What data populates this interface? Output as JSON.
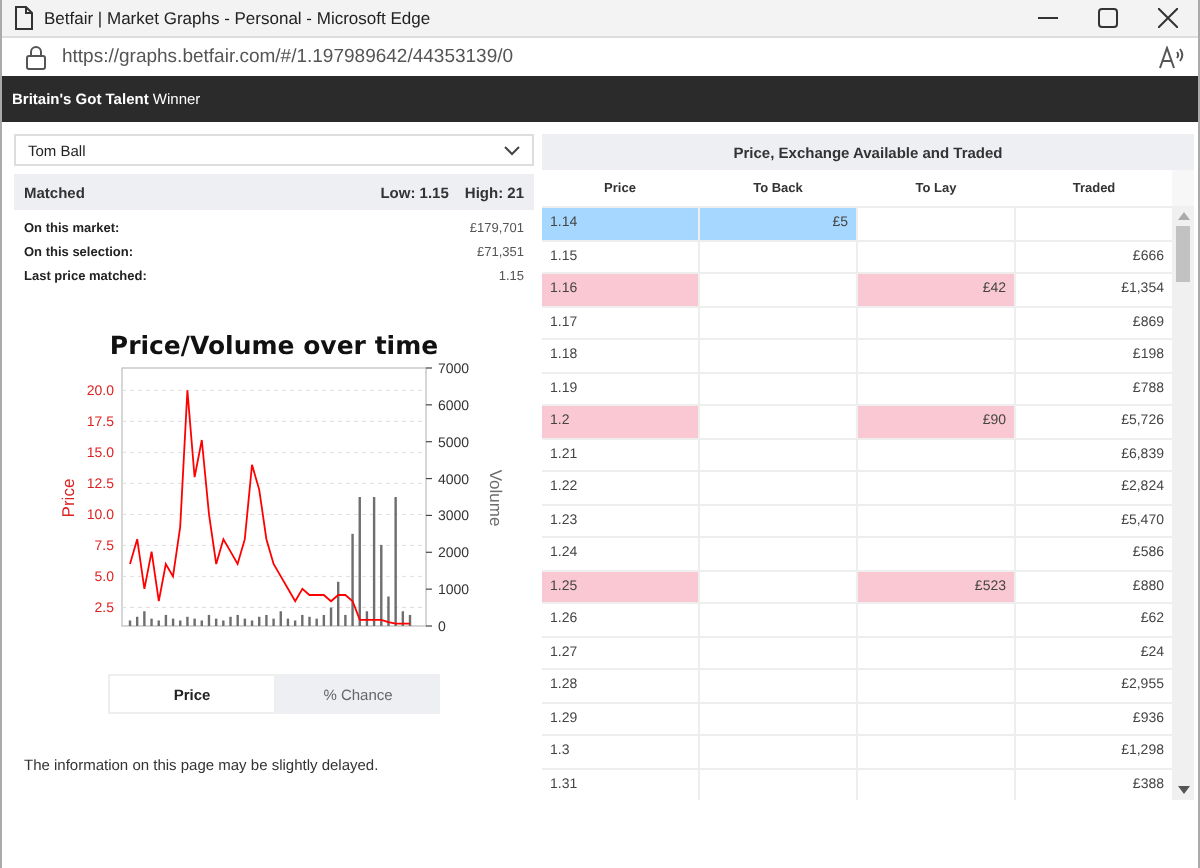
{
  "window": {
    "title": "Betfair | Market Graphs - Personal - Microsoft Edge"
  },
  "address_bar": {
    "url": "https://graphs.betfair.com/#/1.197989642/44353139/0"
  },
  "header": {
    "title": "**Britain's Got Talent** Winner"
  },
  "selection": {
    "value": "Tom Ball"
  },
  "matched": {
    "label": "Matched",
    "low": "Low: 1.15",
    "high": "High: 21"
  },
  "stats": [
    {
      "label": "On this market:",
      "value": "£179,701"
    },
    {
      "label": "On this selection:",
      "value": "£71,351"
    },
    {
      "label": "Last price matched:",
      "value": "1.15"
    }
  ],
  "chart_data": {
    "type": "line",
    "title": "Price/Volume over time",
    "grid": true,
    "ylim": [
      1,
      21.8
    ],
    "y2lim": [
      0,
      7000
    ],
    "yticks": [
      {
        "value": 20,
        "label": "20.0"
      },
      {
        "value": 17.5,
        "label": "17.5"
      },
      {
        "value": 15,
        "label": "15.0"
      },
      {
        "value": 12.5,
        "label": "12.5"
      },
      {
        "value": 10,
        "label": "10.0"
      },
      {
        "value": 7.5,
        "label": "7.5"
      },
      {
        "value": 5,
        "label": "5.0"
      },
      {
        "value": 2.5,
        "label": "2.5"
      }
    ],
    "y2ticks": [
      7000,
      6000,
      5000,
      4000,
      3000,
      2000,
      1000,
      0
    ],
    "series": [
      {
        "name": "Price",
        "color": "#ff0000",
        "values": [
          6,
          8,
          4,
          7,
          3,
          6,
          5,
          9,
          20,
          13,
          16,
          10,
          6,
          8,
          7,
          6,
          8,
          14,
          12,
          8,
          6,
          5,
          4,
          3,
          4,
          3.5,
          3.5,
          3.5,
          3,
          3.5,
          3.5,
          3,
          1.5,
          1.5,
          1.5,
          1.5,
          1.3,
          1.2,
          1.2,
          1.2
        ]
      },
      {
        "name": "Volume",
        "color": "#6e6e6e",
        "type": "bar",
        "axis": "y2",
        "values": [
          150,
          250,
          400,
          200,
          150,
          300,
          200,
          150,
          250,
          200,
          150,
          300,
          200,
          150,
          250,
          300,
          200,
          150,
          250,
          300,
          200,
          400,
          200,
          150,
          300,
          250,
          200,
          300,
          500,
          1200,
          300,
          2500,
          3500,
          400,
          3500,
          2200,
          800,
          3500,
          400,
          300
        ]
      }
    ]
  },
  "toggle": [
    {
      "label": "Price",
      "selected": true
    },
    {
      "label": "% Chance",
      "selected": false
    }
  ],
  "note": "The information on this page may be slightly delayed.",
  "table": {
    "title": "Price, Exchange Available and Traded",
    "columns": [
      "Price",
      "To Back",
      "To Lay",
      "Traded"
    ],
    "rows": [
      {
        "kind": "back",
        "price": "1.14",
        "back": "£5",
        "lay": "",
        "traded": ""
      },
      {
        "kind": "plain",
        "price": "1.15",
        "back": "",
        "lay": "",
        "traded": "£666"
      },
      {
        "kind": "lay",
        "price": "1.16",
        "back": "",
        "lay": "£42",
        "traded": "£1,354"
      },
      {
        "kind": "plain",
        "price": "1.17",
        "back": "",
        "lay": "",
        "traded": "£869"
      },
      {
        "kind": "plain",
        "price": "1.18",
        "back": "",
        "lay": "",
        "traded": "£198"
      },
      {
        "kind": "plain",
        "price": "1.19",
        "back": "",
        "lay": "",
        "traded": "£788"
      },
      {
        "kind": "lay",
        "price": "1.2",
        "back": "",
        "lay": "£90",
        "traded": "£5,726"
      },
      {
        "kind": "plain",
        "price": "1.21",
        "back": "",
        "lay": "",
        "traded": "£6,839"
      },
      {
        "kind": "plain",
        "price": "1.22",
        "back": "",
        "lay": "",
        "traded": "£2,824"
      },
      {
        "kind": "plain",
        "price": "1.23",
        "back": "",
        "lay": "",
        "traded": "£5,470"
      },
      {
        "kind": "plain",
        "price": "1.24",
        "back": "",
        "lay": "",
        "traded": "£586"
      },
      {
        "kind": "lay",
        "price": "1.25",
        "back": "",
        "lay": "£523",
        "traded": "£880"
      },
      {
        "kind": "plain",
        "price": "1.26",
        "back": "",
        "lay": "",
        "traded": "£62"
      },
      {
        "kind": "plain",
        "price": "1.27",
        "back": "",
        "lay": "",
        "traded": "£24"
      },
      {
        "kind": "plain",
        "price": "1.28",
        "back": "",
        "lay": "",
        "traded": "£2,955"
      },
      {
        "kind": "plain",
        "price": "1.29",
        "back": "",
        "lay": "",
        "traded": "£936"
      },
      {
        "kind": "plain",
        "price": "1.3",
        "back": "",
        "lay": "",
        "traded": "£1,298"
      },
      {
        "kind": "plain",
        "price": "1.31",
        "back": "",
        "lay": "",
        "traded": "£388"
      }
    ]
  }
}
